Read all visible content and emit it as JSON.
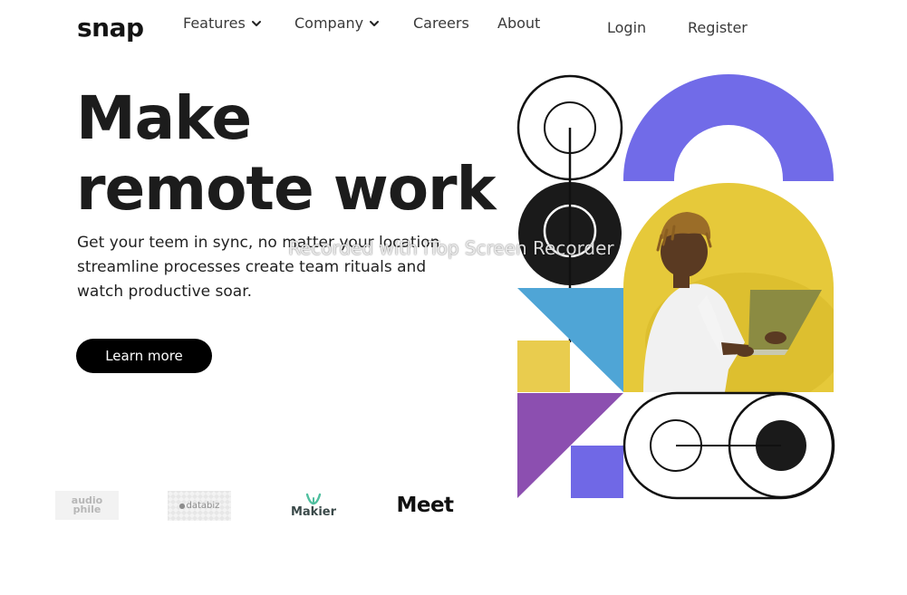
{
  "nav": {
    "logo": "snap",
    "items": [
      {
        "label": "Features",
        "dropdown": true
      },
      {
        "label": "Company",
        "dropdown": true
      },
      {
        "label": "Careers",
        "dropdown": false
      },
      {
        "label": "About",
        "dropdown": false
      }
    ],
    "login": "Login",
    "register": "Register"
  },
  "hero": {
    "title_line1": "Make",
    "title_line2": "remote work",
    "description": "Get your teem in sync, no matter your location streamline processes create team rituals and watch productive soar.",
    "cta_label": "Learn more"
  },
  "brands": [
    {
      "name": "audiophile",
      "line1": "audio",
      "line2": "phile"
    },
    {
      "name": "databiz",
      "text": "databiz"
    },
    {
      "name": "makier",
      "text": "Makier"
    },
    {
      "name": "meet",
      "text": "Meet"
    }
  ],
  "watermark": "Recorded with iTop Screen Recorder",
  "colors": {
    "purple_arch": "#716BE8",
    "yellow": "#E9CC4E",
    "photo_yellow": "#E6C93A",
    "blue": "#4FA5D6",
    "violet": "#8C4FB0",
    "square_purple": "#7068E6",
    "dark": "#1a1a1a"
  }
}
